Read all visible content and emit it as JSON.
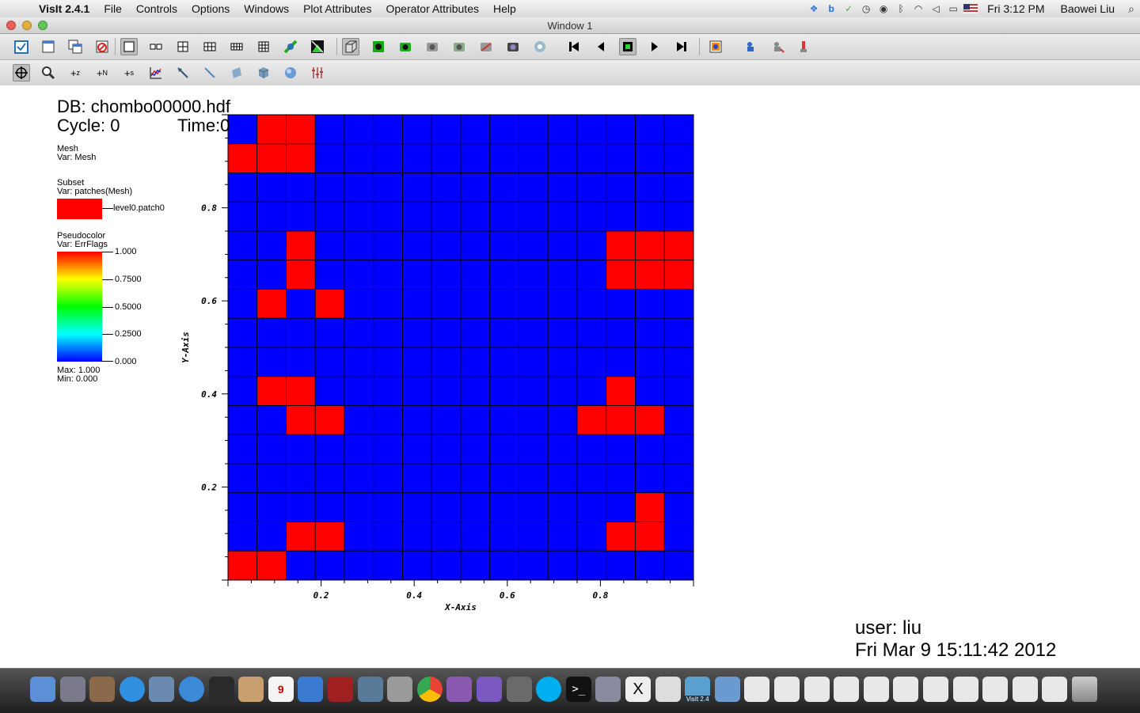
{
  "menubar": {
    "app_name": "VisIt 2.4.1",
    "menus": [
      "File",
      "Controls",
      "Options",
      "Windows",
      "Plot Attributes",
      "Operator Attributes",
      "Help"
    ],
    "status_icons": [
      "dropbox-icon",
      "bing-icon",
      "evernote-icon",
      "time-machine-icon",
      "binoculars-icon",
      "bluetooth-icon",
      "wifi-icon",
      "volume-icon",
      "battery-icon",
      "us-flag-icon"
    ],
    "clock": "Fri 3:12 PM",
    "user": "Baowei Liu"
  },
  "window": {
    "title": "Window 1"
  },
  "toolbar1": {
    "icons": [
      "add-plot-icon",
      "new-window-icon",
      "clone-window-icon",
      "delete-window-icon",
      "layout-1x1-icon",
      "layout-1x2-icon",
      "layout-2x2-icon",
      "layout-2x3-icon",
      "layout-2x4-icon",
      "layout-3x3-icon",
      "lock-view-icon",
      "spin-icon",
      "perspective-icon",
      "reset-view-icon",
      "recenter-icon",
      "undo-view-icon",
      "redo-view-icon",
      "copy-view-icon",
      "save-view-icon",
      "navigate-icon",
      "first-frame-icon",
      "step-back-icon",
      "stop-icon",
      "play-icon",
      "last-frame-icon",
      "save-image-icon",
      "hide-icon",
      "draw-icon",
      "clear-icon"
    ]
  },
  "toolbar2": {
    "icons": [
      "navigate-mode-icon",
      "zoom-mode-icon",
      "zone-pick-icon",
      "node-pick-icon",
      "spreadsheet-pick-icon",
      "lineout-icon",
      "line-tool-icon",
      "plane-tool-icon",
      "point-tool-icon",
      "box-tool-icon",
      "sphere-tool-icon",
      "axis-tool-icon"
    ]
  },
  "annotations": {
    "db": "DB: chombo00000.hdf",
    "cycle": "Cycle: 0",
    "time": "Time:0"
  },
  "legend": {
    "mesh_title": "Mesh",
    "mesh_var": "Var: Mesh",
    "subset_title": "Subset",
    "subset_var": "Var: patches(Mesh)",
    "subset_label": "level0.patch0",
    "pc_title": "Pseudocolor",
    "pc_var": "Var: ErrFlags",
    "ticks": [
      "1.000",
      "0.7500",
      "0.5000",
      "0.2500",
      "0.000"
    ],
    "max": "Max:  1.000",
    "min": "Min:  0.000"
  },
  "colors": {
    "flagged": "#ff0000",
    "unflagged": "#0000ff",
    "gridline": "#000000"
  },
  "chart_data": {
    "type": "heatmap",
    "xlabel": "X-Axis",
    "ylabel": "Y-Axis",
    "xlim": [
      0,
      1
    ],
    "ylim": [
      0,
      1
    ],
    "x_ticks": [
      "0.2",
      "0.4",
      "0.6",
      "0.8"
    ],
    "y_ticks": [
      "0.8",
      "0.6",
      "0.4",
      "0.2"
    ],
    "nx": 16,
    "ny": 16,
    "value_range": [
      0,
      1
    ],
    "rows_top_to_bottom": [
      [
        0,
        1,
        1,
        0,
        0,
        0,
        0,
        0,
        0,
        0,
        0,
        0,
        0,
        0,
        0,
        0
      ],
      [
        1,
        1,
        1,
        0,
        0,
        0,
        0,
        0,
        0,
        0,
        0,
        0,
        0,
        0,
        0,
        0
      ],
      [
        0,
        0,
        0,
        0,
        0,
        0,
        0,
        0,
        0,
        0,
        0,
        0,
        0,
        0,
        0,
        0
      ],
      [
        0,
        0,
        0,
        0,
        0,
        0,
        0,
        0,
        0,
        0,
        0,
        0,
        0,
        0,
        0,
        0
      ],
      [
        0,
        0,
        1,
        0,
        0,
        0,
        0,
        0,
        0,
        0,
        0,
        0,
        0,
        1,
        1,
        1
      ],
      [
        0,
        0,
        1,
        0,
        0,
        0,
        0,
        0,
        0,
        0,
        0,
        0,
        0,
        1,
        1,
        1
      ],
      [
        0,
        1,
        0,
        1,
        0,
        0,
        0,
        0,
        0,
        0,
        0,
        0,
        0,
        0,
        0,
        0
      ],
      [
        0,
        0,
        0,
        0,
        0,
        0,
        0,
        0,
        0,
        0,
        0,
        0,
        0,
        0,
        0,
        0
      ],
      [
        0,
        0,
        0,
        0,
        0,
        0,
        0,
        0,
        0,
        0,
        0,
        0,
        0,
        0,
        0,
        0
      ],
      [
        0,
        1,
        1,
        0,
        0,
        0,
        0,
        0,
        0,
        0,
        0,
        0,
        0,
        1,
        0,
        0
      ],
      [
        0,
        0,
        1,
        1,
        0,
        0,
        0,
        0,
        0,
        0,
        0,
        0,
        1,
        1,
        1,
        0
      ],
      [
        0,
        0,
        0,
        0,
        0,
        0,
        0,
        0,
        0,
        0,
        0,
        0,
        0,
        0,
        0,
        0
      ],
      [
        0,
        0,
        0,
        0,
        0,
        0,
        0,
        0,
        0,
        0,
        0,
        0,
        0,
        0,
        0,
        0
      ],
      [
        0,
        0,
        0,
        0,
        0,
        0,
        0,
        0,
        0,
        0,
        0,
        0,
        0,
        0,
        1,
        0
      ],
      [
        0,
        0,
        1,
        1,
        0,
        0,
        0,
        0,
        0,
        0,
        0,
        0,
        0,
        1,
        1,
        0
      ],
      [
        1,
        1,
        0,
        0,
        0,
        0,
        0,
        0,
        0,
        0,
        0,
        0,
        0,
        0,
        0,
        0
      ]
    ]
  },
  "footer": {
    "user": "user: liu",
    "date": "Fri Mar  9 15:11:42 2012"
  },
  "dock": {
    "apps": [
      "finder-icon",
      "launchpad-icon",
      "system-info-icon",
      "app-store-icon",
      "preview-icon",
      "safari-icon",
      "facetime-icon",
      "address-book-icon",
      "calendar-icon",
      "itunes-icon",
      "photo-booth-icon",
      "iphoto-icon",
      "system-preferences-icon",
      "chrome-icon",
      "emacs-icon",
      "texshop-icon",
      "utilities-icon",
      "skype-icon",
      "terminal-icon",
      "image-capture-icon",
      "x11-icon",
      "texteditor-icon",
      "visit-icon",
      "applications-folder-icon",
      "document-tex-icon",
      "document-icon",
      "document-icon",
      "document-icon",
      "document-icon",
      "document-icon",
      "document-icon",
      "document-icon",
      "document-icon",
      "document-icon",
      "document-icon",
      "trash-icon"
    ],
    "visit_label": "VisIt 2.4"
  }
}
